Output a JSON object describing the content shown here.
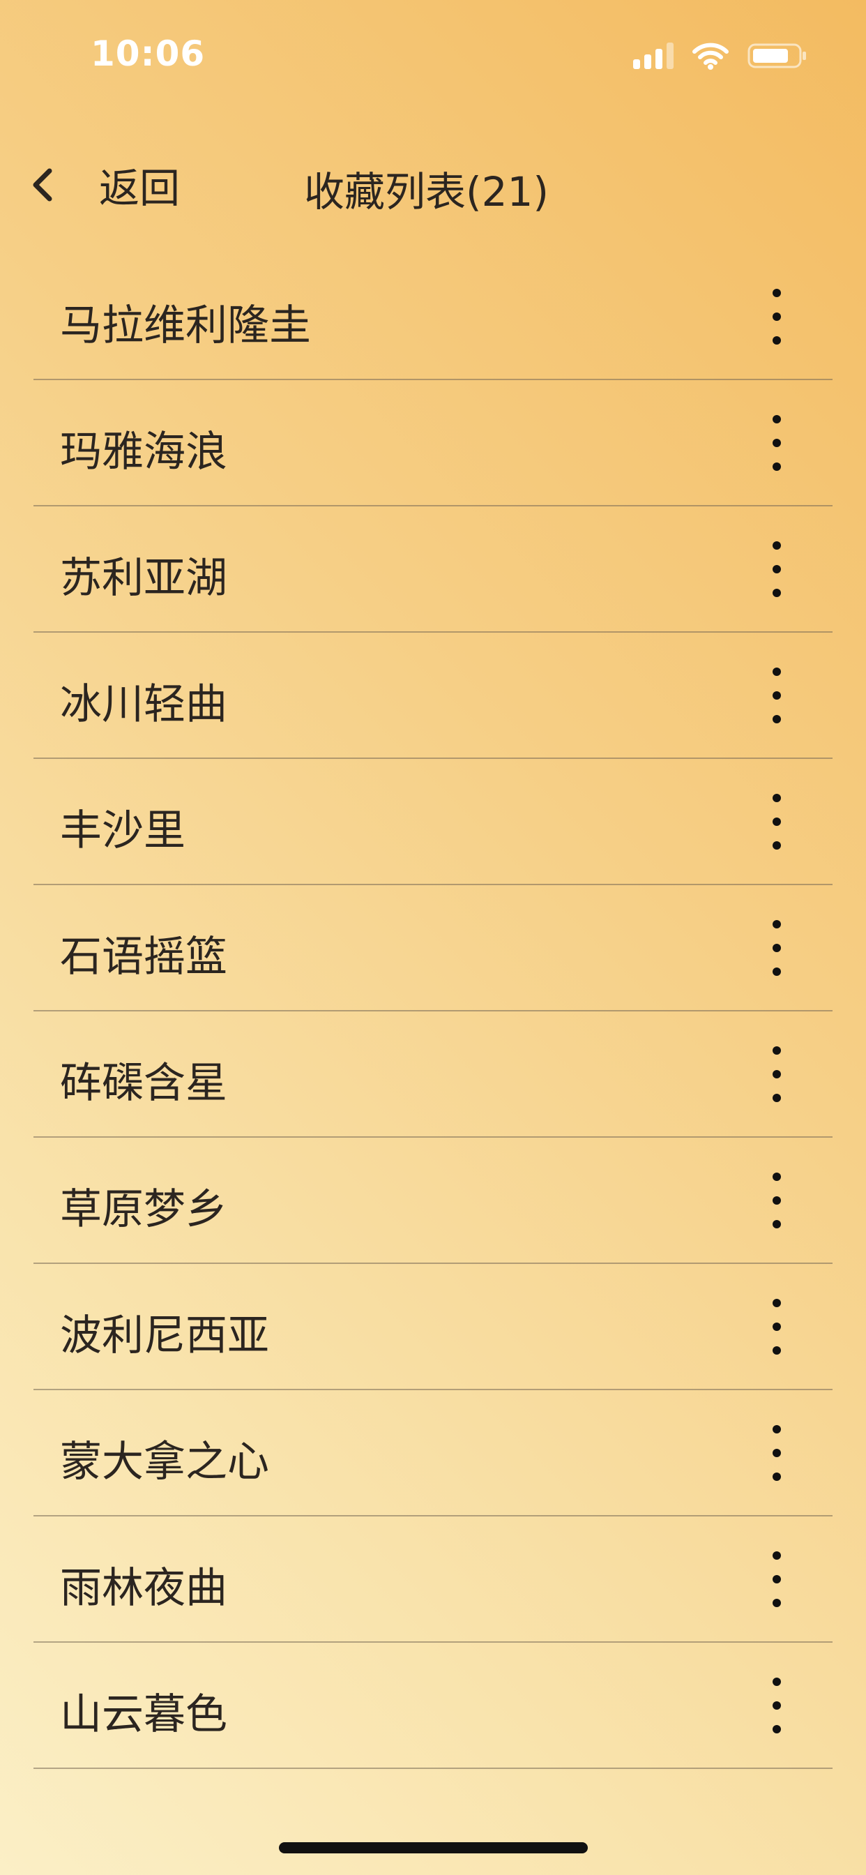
{
  "status_bar": {
    "time": "10:06",
    "icons": [
      "cellular-signal-icon",
      "wifi-icon",
      "battery-icon"
    ],
    "icon_color": "#ffffff"
  },
  "header": {
    "back_label": "返回",
    "back_icon": "chevron-left-icon",
    "title": "收藏列表(21)"
  },
  "list": {
    "more_icon": "vertical-ellipsis-icon",
    "items": [
      {
        "title": "马拉维利隆圭"
      },
      {
        "title": "玛雅海浪"
      },
      {
        "title": "苏利亚湖"
      },
      {
        "title": "冰川轻曲"
      },
      {
        "title": "丰沙里"
      },
      {
        "title": "石语摇篮"
      },
      {
        "title": "砗磲含星"
      },
      {
        "title": "草原梦乡"
      },
      {
        "title": "波利尼西亚"
      },
      {
        "title": "蒙大拿之心"
      },
      {
        "title": "雨林夜曲"
      },
      {
        "title": "山云暮色"
      }
    ]
  },
  "colors": {
    "background_top_right": "#f3bb61",
    "background_bottom_left": "#fbefc6",
    "text": "#2b2520",
    "divider": "#786955"
  }
}
